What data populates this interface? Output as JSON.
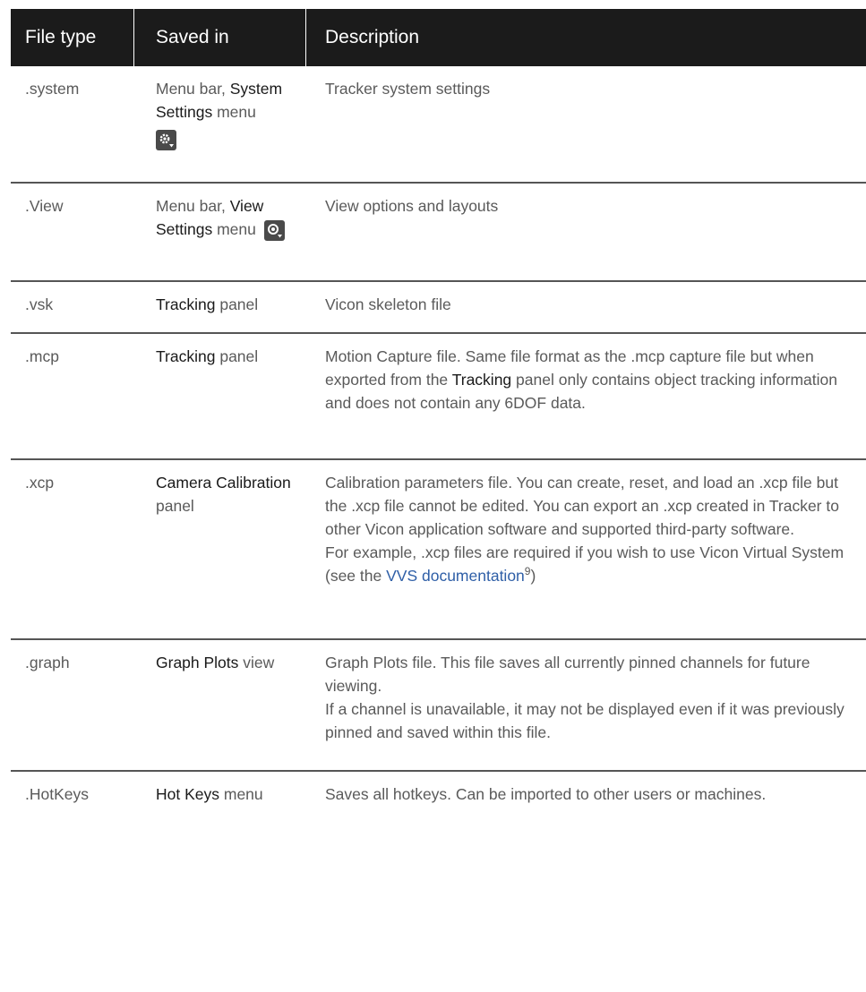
{
  "header": {
    "col1": "File type",
    "col2": "Saved in",
    "col3": "Description"
  },
  "rows": [
    {
      "type": ".system",
      "saved_in": {
        "l1": "Menu bar,",
        "strong": "System Settings",
        "rest": "menu",
        "icon": "gear-dropdown-icon"
      },
      "description": "Tracker system settings"
    },
    {
      "type": ".View",
      "saved_in": {
        "l1": "Menu bar,",
        "strong": "View Settings",
        "rest": "menu",
        "icon": "eye-dropdown-icon"
      },
      "description": "View options and layouts"
    },
    {
      "type": ".vsk",
      "saved_in": {
        "strong": "Tracking",
        "rest": "panel"
      },
      "description": "Vicon skeleton file"
    },
    {
      "type": ".mcp",
      "saved_in": {
        "strong": "Tracking",
        "rest": "panel"
      },
      "description": {
        "a": "Motion Capture file. Same file format as the .mcp capture file but when exported from the",
        "strong": "Tracking",
        "b": "panel only contains object tracking information and does not contain any 6DOF data."
      }
    },
    {
      "type": ".xcp",
      "saved_in": {
        "strong": "Camera Calibration",
        "rest": "panel"
      },
      "description": {
        "p1": "Calibration parameters file. You can create, reset, and load an .xcp file but the .xcp file cannot be edited. You can export an .xcp created in Tracker to other Vicon application software and supported third-party software.",
        "p2a": "For example, .xcp files are required if you wish to use Vicon Virtual System (see the",
        "link": "VVS documentation",
        "footnote": "9",
        "p2b": ")"
      }
    },
    {
      "type": ".graph",
      "saved_in": {
        "strong": "Graph Plots",
        "rest": "view"
      },
      "description": {
        "p1": "Graph Plots file. This file saves all currently pinned channels for future viewing.",
        "p2": "If a channel is unavailable, it may not be displayed even if it was previously pinned and saved within this file."
      }
    },
    {
      "type": ".HotKeys",
      "saved_in": {
        "strong": "Hot Keys",
        "rest": "menu"
      },
      "description": "Saves all hotkeys. Can be imported to other users or machines."
    }
  ]
}
